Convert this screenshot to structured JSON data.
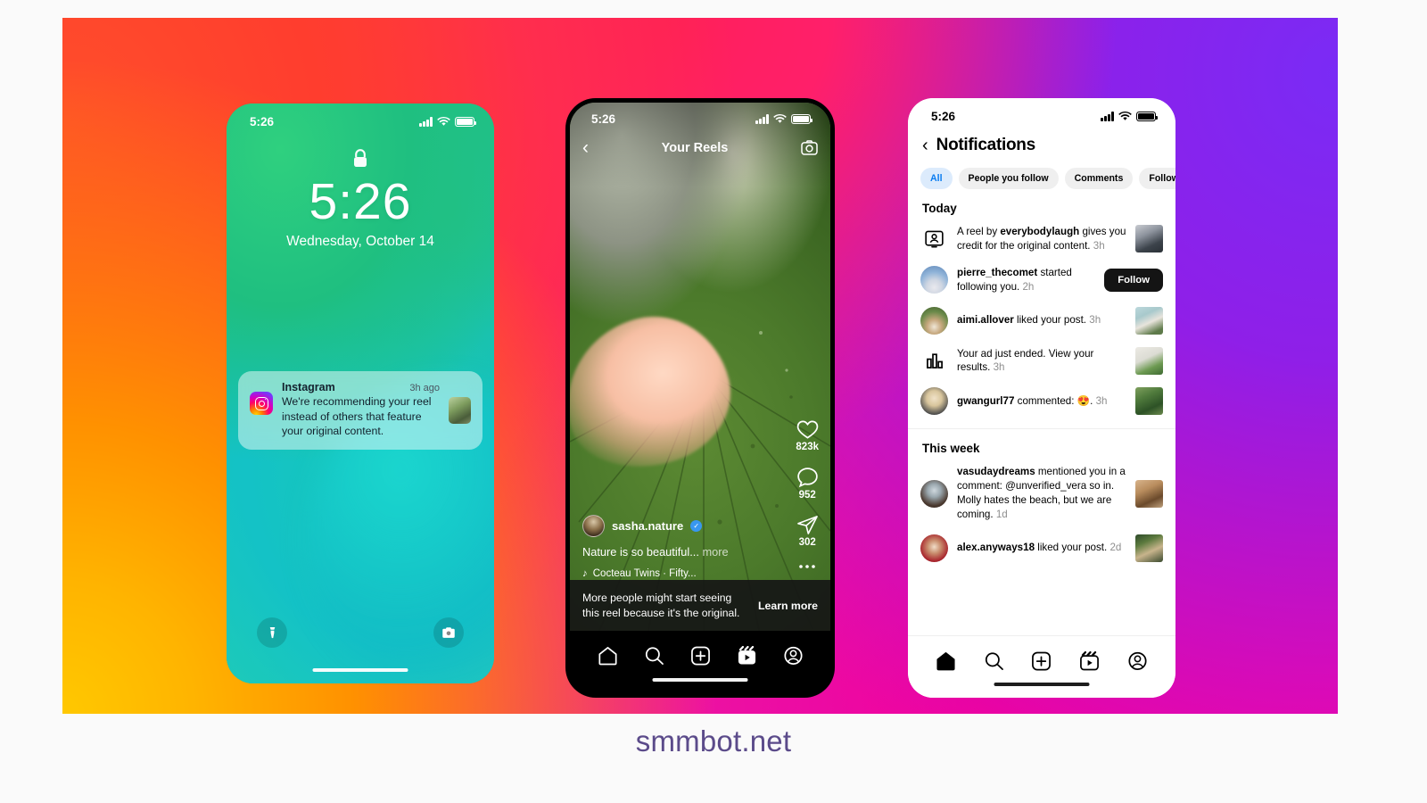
{
  "brand": {
    "watermark": "smmbot.net",
    "accent": "#0a7cf0",
    "ig_gradient": "#d300c5"
  },
  "lockscreen": {
    "status": {
      "time": "5:26",
      "signal_icon": "cellular-bars-icon",
      "wifi_icon": "wifi-icon",
      "battery_icon": "battery-icon"
    },
    "lock_icon": "lock-icon",
    "clock": "5:26",
    "date": "Wednesday, October 14",
    "notification": {
      "app": "Instagram",
      "time": "3h ago",
      "text": "We're recommending your reel instead of others that feature your original content.",
      "app_icon": "instagram-icon",
      "thumb": "reel-thumbnail"
    },
    "flashlight_icon": "flashlight-icon",
    "camera_icon": "camera-icon"
  },
  "reels": {
    "status": {
      "time": "5:26"
    },
    "back_icon": "chevron-left-icon",
    "title": "Your Reels",
    "camera_icon": "camera-icon",
    "actions": [
      {
        "icon": "heart-icon",
        "count": "823k"
      },
      {
        "icon": "comment-icon",
        "count": "952"
      },
      {
        "icon": "share-icon",
        "count": "302"
      },
      {
        "icon": "more-options-icon",
        "count": ""
      }
    ],
    "username": "sasha.nature",
    "verified_icon": "verified-badge-icon",
    "caption": "Nature is so beautiful...",
    "caption_more": "more",
    "audio_icon": "music-note-icon",
    "audio": "Cocteau Twins · Fifty...",
    "banner": {
      "text": "More people might start seeing this reel because it's the original.",
      "cta": "Learn more"
    },
    "tabbar": [
      {
        "icon": "home-icon",
        "label": "Home"
      },
      {
        "icon": "search-icon",
        "label": "Search"
      },
      {
        "icon": "create-icon",
        "label": "Create"
      },
      {
        "icon": "reels-icon",
        "label": "Reels"
      },
      {
        "icon": "profile-icon",
        "label": "Profile"
      }
    ]
  },
  "notifications": {
    "status": {
      "time": "5:26"
    },
    "back_icon": "chevron-left-icon",
    "title": "Notifications",
    "filters": [
      {
        "label": "All",
        "active": true
      },
      {
        "label": "People you follow",
        "active": false
      },
      {
        "label": "Comments",
        "active": false
      },
      {
        "label": "Follows",
        "active": false
      }
    ],
    "sections": [
      {
        "title": "Today",
        "items": [
          {
            "icon": "reel-credit-icon",
            "avatar_class": "",
            "prefix": "A reel by ",
            "strong": "everybodylaugh",
            "suffix": " gives you credit for the original content.",
            "time": "3h",
            "thumb_class": "th-1",
            "action": ""
          },
          {
            "icon": "",
            "avatar_class": "av-pierre",
            "prefix": "",
            "strong": "pierre_thecomet",
            "suffix": " started following you.",
            "time": "2h",
            "thumb_class": "",
            "action": "Follow"
          },
          {
            "icon": "",
            "avatar_class": "av-aimi",
            "prefix": "",
            "strong": "aimi.allover",
            "suffix": " liked your post.",
            "time": "3h",
            "thumb_class": "th-2",
            "action": ""
          },
          {
            "icon": "bar-chart-icon",
            "avatar_class": "",
            "prefix": "",
            "strong": "",
            "suffix": "Your ad just ended. View your results.",
            "time": "3h",
            "thumb_class": "th-3",
            "action": ""
          },
          {
            "icon": "",
            "avatar_class": "av-gwan",
            "prefix": "",
            "strong": "gwangurl77",
            "suffix": " commented: 😍.",
            "time": "3h",
            "thumb_class": "th-4",
            "action": ""
          }
        ]
      },
      {
        "title": "This week",
        "items": [
          {
            "icon": "",
            "avatar_class": "av-vasu",
            "prefix": "",
            "strong": "vasudaydreams",
            "suffix": " mentioned you in a comment: @unverified_vera so in. Molly hates the beach, but we are coming.",
            "time": "1d",
            "thumb_class": "th-5",
            "action": ""
          },
          {
            "icon": "",
            "avatar_class": "av-alex",
            "prefix": "",
            "strong": "alex.anyways18",
            "suffix": " liked your post.",
            "time": "2d",
            "thumb_class": "th-6",
            "action": ""
          }
        ]
      }
    ],
    "tabbar": [
      {
        "icon": "home-icon",
        "label": "Home"
      },
      {
        "icon": "search-icon",
        "label": "Search"
      },
      {
        "icon": "create-icon",
        "label": "Create"
      },
      {
        "icon": "reels-icon",
        "label": "Reels"
      },
      {
        "icon": "profile-icon",
        "label": "Profile"
      }
    ]
  }
}
